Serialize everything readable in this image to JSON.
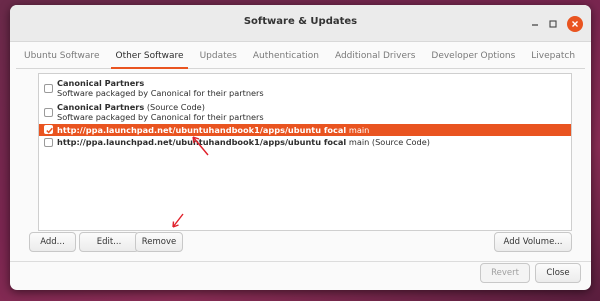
{
  "window": {
    "title": "Software & Updates"
  },
  "titlebar": {
    "icons": [
      "minimize-icon",
      "maximize-icon",
      "close-icon"
    ]
  },
  "tabs": [
    {
      "label": "Ubuntu Software"
    },
    {
      "label": "Other Software"
    },
    {
      "label": "Updates"
    },
    {
      "label": "Authentication"
    },
    {
      "label": "Additional Drivers"
    },
    {
      "label": "Developer Options"
    },
    {
      "label": "Livepatch"
    }
  ],
  "active_tab": "Other Software",
  "sources": [
    {
      "title": "Canonical Partners",
      "subtitle": "Software packaged by Canonical for their partners",
      "checked": false
    },
    {
      "title": "Canonical Partners",
      "title_suffix": " (Source Code)",
      "subtitle": "Software packaged by Canonical for their partners",
      "checked": false
    },
    {
      "url": "http://ppa.launchpad.net/ubuntuhandbook1/apps/ubuntu focal",
      "suffix": " main",
      "checked": true,
      "selected": true
    },
    {
      "url": "http://ppa.launchpad.net/ubuntuhandbook1/apps/ubuntu focal",
      "suffix": " main (Source Code)",
      "checked": false
    }
  ],
  "buttons": {
    "add": "Add...",
    "edit": "Edit...",
    "remove": "Remove",
    "add_volume": "Add Volume...",
    "revert": "Revert",
    "close": "Close"
  },
  "colors": {
    "accent": "#e95420",
    "annotation": "#e0202a"
  }
}
